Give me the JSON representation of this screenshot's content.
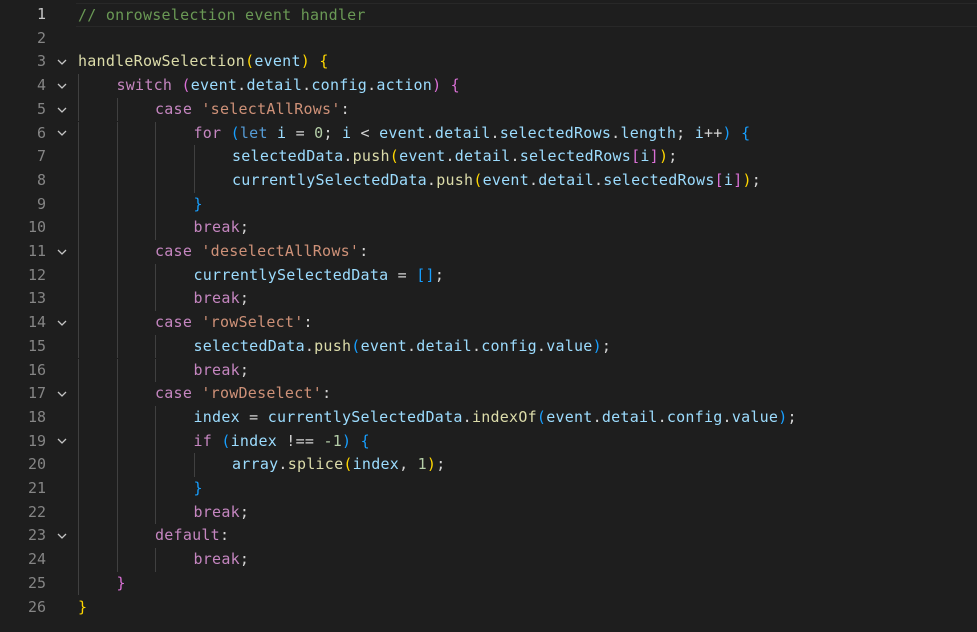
{
  "editor": {
    "lines": [
      {
        "num": "1",
        "fold": false,
        "indent": 0,
        "active": true,
        "tokens": [
          {
            "t": "// onrowselection event handler",
            "c": "comment"
          }
        ]
      },
      {
        "num": "2",
        "fold": false,
        "indent": 0,
        "tokens": []
      },
      {
        "num": "3",
        "fold": true,
        "indent": 0,
        "tokens": [
          {
            "t": "handleRowSelection",
            "c": "func"
          },
          {
            "t": "(",
            "c": "b1"
          },
          {
            "t": "event",
            "c": "var"
          },
          {
            "t": ")",
            "c": "b1"
          },
          {
            "t": " ",
            "c": "punc"
          },
          {
            "t": "{",
            "c": "b1"
          }
        ]
      },
      {
        "num": "4",
        "fold": true,
        "indent": 1,
        "tokens": [
          {
            "t": "switch",
            "c": "ctrl"
          },
          {
            "t": " ",
            "c": "punc"
          },
          {
            "t": "(",
            "c": "b2"
          },
          {
            "t": "event",
            "c": "var"
          },
          {
            "t": ".",
            "c": "punc"
          },
          {
            "t": "detail",
            "c": "var"
          },
          {
            "t": ".",
            "c": "punc"
          },
          {
            "t": "config",
            "c": "var"
          },
          {
            "t": ".",
            "c": "punc"
          },
          {
            "t": "action",
            "c": "var"
          },
          {
            "t": ")",
            "c": "b2"
          },
          {
            "t": " ",
            "c": "punc"
          },
          {
            "t": "{",
            "c": "b2"
          }
        ]
      },
      {
        "num": "5",
        "fold": true,
        "indent": 2,
        "tokens": [
          {
            "t": "case",
            "c": "ctrl"
          },
          {
            "t": " ",
            "c": "punc"
          },
          {
            "t": "'selectAllRows'",
            "c": "str"
          },
          {
            "t": ":",
            "c": "punc"
          }
        ]
      },
      {
        "num": "6",
        "fold": true,
        "indent": 3,
        "tokens": [
          {
            "t": "for",
            "c": "ctrl"
          },
          {
            "t": " ",
            "c": "punc"
          },
          {
            "t": "(",
            "c": "b3"
          },
          {
            "t": "let",
            "c": "keyword"
          },
          {
            "t": " ",
            "c": "punc"
          },
          {
            "t": "i",
            "c": "var"
          },
          {
            "t": " = ",
            "c": "punc"
          },
          {
            "t": "0",
            "c": "num"
          },
          {
            "t": "; ",
            "c": "punc"
          },
          {
            "t": "i",
            "c": "var"
          },
          {
            "t": " < ",
            "c": "punc"
          },
          {
            "t": "event",
            "c": "var"
          },
          {
            "t": ".",
            "c": "punc"
          },
          {
            "t": "detail",
            "c": "var"
          },
          {
            "t": ".",
            "c": "punc"
          },
          {
            "t": "selectedRows",
            "c": "var"
          },
          {
            "t": ".",
            "c": "punc"
          },
          {
            "t": "length",
            "c": "var"
          },
          {
            "t": "; ",
            "c": "punc"
          },
          {
            "t": "i",
            "c": "var"
          },
          {
            "t": "++",
            "c": "punc"
          },
          {
            "t": ")",
            "c": "b3"
          },
          {
            "t": " ",
            "c": "punc"
          },
          {
            "t": "{",
            "c": "b3"
          }
        ]
      },
      {
        "num": "7",
        "fold": false,
        "indent": 4,
        "tokens": [
          {
            "t": "selectedData",
            "c": "var"
          },
          {
            "t": ".",
            "c": "punc"
          },
          {
            "t": "push",
            "c": "func"
          },
          {
            "t": "(",
            "c": "b1"
          },
          {
            "t": "event",
            "c": "var"
          },
          {
            "t": ".",
            "c": "punc"
          },
          {
            "t": "detail",
            "c": "var"
          },
          {
            "t": ".",
            "c": "punc"
          },
          {
            "t": "selectedRows",
            "c": "var"
          },
          {
            "t": "[",
            "c": "b2"
          },
          {
            "t": "i",
            "c": "var"
          },
          {
            "t": "]",
            "c": "b2"
          },
          {
            "t": ")",
            "c": "b1"
          },
          {
            "t": ";",
            "c": "punc"
          }
        ]
      },
      {
        "num": "8",
        "fold": false,
        "indent": 4,
        "tokens": [
          {
            "t": "currentlySelectedData",
            "c": "var"
          },
          {
            "t": ".",
            "c": "punc"
          },
          {
            "t": "push",
            "c": "func"
          },
          {
            "t": "(",
            "c": "b1"
          },
          {
            "t": "event",
            "c": "var"
          },
          {
            "t": ".",
            "c": "punc"
          },
          {
            "t": "detail",
            "c": "var"
          },
          {
            "t": ".",
            "c": "punc"
          },
          {
            "t": "selectedRows",
            "c": "var"
          },
          {
            "t": "[",
            "c": "b2"
          },
          {
            "t": "i",
            "c": "var"
          },
          {
            "t": "]",
            "c": "b2"
          },
          {
            "t": ")",
            "c": "b1"
          },
          {
            "t": ";",
            "c": "punc"
          }
        ]
      },
      {
        "num": "9",
        "fold": false,
        "indent": 3,
        "tokens": [
          {
            "t": "}",
            "c": "b3"
          }
        ]
      },
      {
        "num": "10",
        "fold": false,
        "indent": 3,
        "tokens": [
          {
            "t": "break",
            "c": "ctrl"
          },
          {
            "t": ";",
            "c": "punc"
          }
        ]
      },
      {
        "num": "11",
        "fold": true,
        "indent": 2,
        "tokens": [
          {
            "t": "case",
            "c": "ctrl"
          },
          {
            "t": " ",
            "c": "punc"
          },
          {
            "t": "'deselectAllRows'",
            "c": "str"
          },
          {
            "t": ":",
            "c": "punc"
          }
        ]
      },
      {
        "num": "12",
        "fold": false,
        "indent": 3,
        "tokens": [
          {
            "t": "currentlySelectedData",
            "c": "var"
          },
          {
            "t": " = ",
            "c": "punc"
          },
          {
            "t": "[]",
            "c": "b3"
          },
          {
            "t": ";",
            "c": "punc"
          }
        ]
      },
      {
        "num": "13",
        "fold": false,
        "indent": 3,
        "tokens": [
          {
            "t": "break",
            "c": "ctrl"
          },
          {
            "t": ";",
            "c": "punc"
          }
        ]
      },
      {
        "num": "14",
        "fold": true,
        "indent": 2,
        "tokens": [
          {
            "t": "case",
            "c": "ctrl"
          },
          {
            "t": " ",
            "c": "punc"
          },
          {
            "t": "'rowSelect'",
            "c": "str"
          },
          {
            "t": ":",
            "c": "punc"
          }
        ]
      },
      {
        "num": "15",
        "fold": false,
        "indent": 3,
        "tokens": [
          {
            "t": "selectedData",
            "c": "var"
          },
          {
            "t": ".",
            "c": "punc"
          },
          {
            "t": "push",
            "c": "func"
          },
          {
            "t": "(",
            "c": "b3"
          },
          {
            "t": "event",
            "c": "var"
          },
          {
            "t": ".",
            "c": "punc"
          },
          {
            "t": "detail",
            "c": "var"
          },
          {
            "t": ".",
            "c": "punc"
          },
          {
            "t": "config",
            "c": "var"
          },
          {
            "t": ".",
            "c": "punc"
          },
          {
            "t": "value",
            "c": "var"
          },
          {
            "t": ")",
            "c": "b3"
          },
          {
            "t": ";",
            "c": "punc"
          }
        ]
      },
      {
        "num": "16",
        "fold": false,
        "indent": 3,
        "tokens": [
          {
            "t": "break",
            "c": "ctrl"
          },
          {
            "t": ";",
            "c": "punc"
          }
        ]
      },
      {
        "num": "17",
        "fold": true,
        "indent": 2,
        "tokens": [
          {
            "t": "case",
            "c": "ctrl"
          },
          {
            "t": " ",
            "c": "punc"
          },
          {
            "t": "'rowDeselect'",
            "c": "str"
          },
          {
            "t": ":",
            "c": "punc"
          }
        ]
      },
      {
        "num": "18",
        "fold": false,
        "indent": 3,
        "tokens": [
          {
            "t": "index",
            "c": "var"
          },
          {
            "t": " = ",
            "c": "punc"
          },
          {
            "t": "currentlySelectedData",
            "c": "var"
          },
          {
            "t": ".",
            "c": "punc"
          },
          {
            "t": "indexOf",
            "c": "func"
          },
          {
            "t": "(",
            "c": "b3"
          },
          {
            "t": "event",
            "c": "var"
          },
          {
            "t": ".",
            "c": "punc"
          },
          {
            "t": "detail",
            "c": "var"
          },
          {
            "t": ".",
            "c": "punc"
          },
          {
            "t": "config",
            "c": "var"
          },
          {
            "t": ".",
            "c": "punc"
          },
          {
            "t": "value",
            "c": "var"
          },
          {
            "t": ")",
            "c": "b3"
          },
          {
            "t": ";",
            "c": "punc"
          }
        ]
      },
      {
        "num": "19",
        "fold": true,
        "indent": 3,
        "tokens": [
          {
            "t": "if",
            "c": "ctrl"
          },
          {
            "t": " ",
            "c": "punc"
          },
          {
            "t": "(",
            "c": "b3"
          },
          {
            "t": "index",
            "c": "var"
          },
          {
            "t": " !== ",
            "c": "punc"
          },
          {
            "t": "-1",
            "c": "num"
          },
          {
            "t": ")",
            "c": "b3"
          },
          {
            "t": " ",
            "c": "punc"
          },
          {
            "t": "{",
            "c": "b3"
          }
        ]
      },
      {
        "num": "20",
        "fold": false,
        "indent": 4,
        "tokens": [
          {
            "t": "array",
            "c": "var"
          },
          {
            "t": ".",
            "c": "punc"
          },
          {
            "t": "splice",
            "c": "func"
          },
          {
            "t": "(",
            "c": "b1"
          },
          {
            "t": "index",
            "c": "var"
          },
          {
            "t": ", ",
            "c": "punc"
          },
          {
            "t": "1",
            "c": "num"
          },
          {
            "t": ")",
            "c": "b1"
          },
          {
            "t": ";",
            "c": "punc"
          }
        ]
      },
      {
        "num": "21",
        "fold": false,
        "indent": 3,
        "tokens": [
          {
            "t": "}",
            "c": "b3"
          }
        ]
      },
      {
        "num": "22",
        "fold": false,
        "indent": 3,
        "tokens": [
          {
            "t": "break",
            "c": "ctrl"
          },
          {
            "t": ";",
            "c": "punc"
          }
        ]
      },
      {
        "num": "23",
        "fold": true,
        "indent": 2,
        "tokens": [
          {
            "t": "default",
            "c": "ctrl"
          },
          {
            "t": ":",
            "c": "punc"
          }
        ]
      },
      {
        "num": "24",
        "fold": false,
        "indent": 3,
        "tokens": [
          {
            "t": "break",
            "c": "ctrl"
          },
          {
            "t": ";",
            "c": "punc"
          }
        ]
      },
      {
        "num": "25",
        "fold": false,
        "indent": 1,
        "tokens": [
          {
            "t": "}",
            "c": "b2"
          }
        ]
      },
      {
        "num": "26",
        "fold": false,
        "indent": 0,
        "tokens": [
          {
            "t": "}",
            "c": "b1"
          }
        ]
      }
    ]
  },
  "colors": {
    "background": "#1e1e1e",
    "line_number": "#858585",
    "line_number_active": "#c6c6c6",
    "comment": "#6a9955",
    "control_keyword": "#c586c0",
    "keyword": "#569cd6",
    "function": "#dcdcaa",
    "variable": "#9cdcfe",
    "string": "#ce9178",
    "number": "#b5cea8",
    "bracket_level_1": "#ffd700",
    "bracket_level_2": "#da70d6",
    "bracket_level_3": "#179fff"
  },
  "icons": {
    "fold": "chevron-down-icon"
  }
}
